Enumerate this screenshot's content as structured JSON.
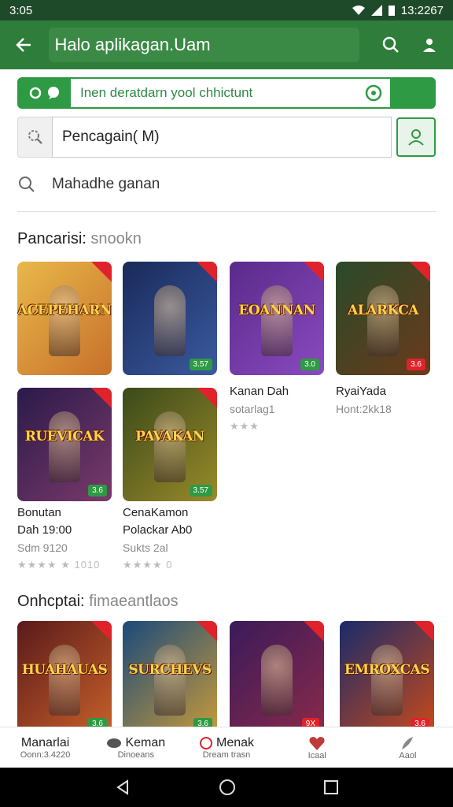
{
  "status_bar": {
    "time": "3:05",
    "clock_right": "13:2267"
  },
  "app_bar": {
    "title": "Halo aplikagan.Uam"
  },
  "search_bar_top": {
    "placeholder": "Inen deratdarn yool chhictunt"
  },
  "search_bar_main": {
    "value": "Pencagain( M)"
  },
  "suggestion": {
    "text": "Mahadhe ganan"
  },
  "section1": {
    "title": "Pancarisi:",
    "subtitle": "snookn",
    "cards": [
      {
        "art": "ACEPEHARN",
        "badge": "",
        "colors": [
          "#e8b84a",
          "#c8702a"
        ]
      },
      {
        "art": "",
        "badge": "3.57",
        "colors": [
          "#1a2a5a",
          "#3a5aa0"
        ]
      },
      {
        "art": "EOANNAN",
        "badge": "3.0",
        "colors": [
          "#5a2a8a",
          "#8a4ac0"
        ]
      },
      {
        "art": "ALARKCA",
        "badge": "3.6",
        "colors": [
          "#2a4a2a",
          "#6a3a1a"
        ]
      },
      {
        "art": "RUEVICAK",
        "badge": "3.6",
        "colors": [
          "#2a1a4a",
          "#7a3a6a"
        ]
      },
      {
        "art": "PAVAKAN",
        "badge": "3.57",
        "colors": [
          "#3a4a1a",
          "#9a8a2a"
        ]
      }
    ],
    "meta_right": [
      {
        "name": "Kanan Dah",
        "sub": "sotarlag1",
        "rating": "★★★"
      },
      {
        "name": "RyaiYada",
        "sub": "Hont:2kk18",
        "rating": ""
      }
    ],
    "meta_bottom": [
      {
        "name": "Bonutan",
        "name2": "Dah 19:00",
        "sub": "Sdm 9120",
        "rating": "★★★★ ★ 1010"
      },
      {
        "name": "CenaKamon",
        "name2": "Polackar Ab0",
        "sub": "Sukts 2al",
        "rating": "★★★★ 0"
      }
    ]
  },
  "section2": {
    "title": "Onhcptai:",
    "subtitle": "fimaeantlaos",
    "cards": [
      {
        "art": "HUAHAUAS",
        "badge": "3.6",
        "colors": [
          "#5a1a1a",
          "#c8602a"
        ]
      },
      {
        "art": "SURCHEVS",
        "badge": "3.6",
        "colors": [
          "#1a4a7a",
          "#c89a3a"
        ]
      },
      {
        "art": "",
        "badge": "9X",
        "colors": [
          "#3a1a5a",
          "#8a2a4a"
        ]
      },
      {
        "art": "EMROXCAS",
        "badge": "3.6",
        "colors": [
          "#1a2a6a",
          "#c84a1a"
        ]
      }
    ]
  },
  "bottom_nav": [
    {
      "label": "Manarlai",
      "small": "Oonn:3.4220"
    },
    {
      "label": "Keman",
      "small": "Dinoeans"
    },
    {
      "label": "Menak",
      "small": "Dream trasn"
    },
    {
      "label": "",
      "small": "Icaal"
    },
    {
      "label": "",
      "small": "Aaol"
    }
  ],
  "colors": {
    "primary": "#2e7d3a",
    "accent": "#2e9a44",
    "badge_red": "#e0232b"
  }
}
